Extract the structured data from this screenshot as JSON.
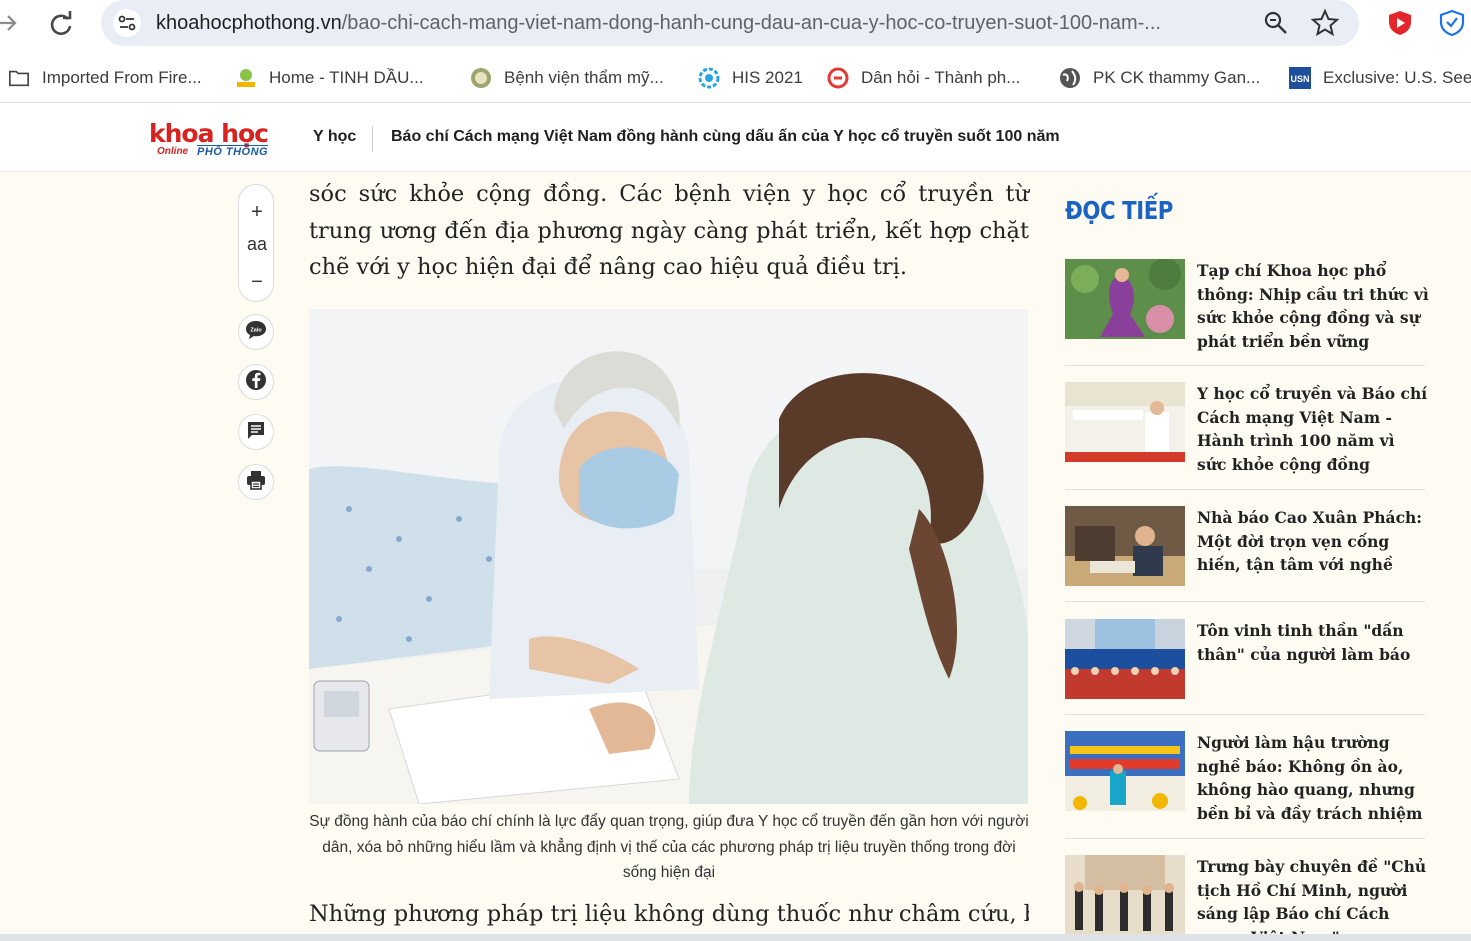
{
  "browser": {
    "url_host": "khoahocphothong.vn",
    "url_path": "/bao-chi-cach-mang-viet-nam-dong-hanh-cung-dau-an-cua-y-hoc-co-truyen-suot-100-nam-...",
    "bookmarks": [
      {
        "label": "Imported From Fire...",
        "icon": "folder-icon"
      },
      {
        "label": "Home - TINH DẦU...",
        "icon": "site-icon"
      },
      {
        "label": "Bệnh viện thẩm mỹ...",
        "icon": "site-icon"
      },
      {
        "label": "HIS 2021",
        "icon": "gear-site-icon"
      },
      {
        "label": "Dân hỏi - Thành ph...",
        "icon": "site-icon"
      },
      {
        "label": "PK CK thammy Gan...",
        "icon": "globe-icon"
      },
      {
        "label": "Exclusive: U.S. Sees",
        "icon": "usn-icon"
      }
    ]
  },
  "header": {
    "logo_main": "khoa học",
    "logo_sub": "Online",
    "logo_sub2": "PHỔ THÔNG",
    "category": "Y học",
    "title": "Báo chí Cách mạng Việt Nam đồng hành cùng dấu ấn của Y học cổ truyền suốt 100 năm"
  },
  "tools": {
    "zoom_in": "+",
    "font_label": "aa",
    "zoom_out": "−"
  },
  "article": {
    "lead": "sóc sức khỏe cộng đồng. Các bệnh viện y học cổ truyền từ trung ương đến địa phương ngày càng phát triển, kết hợp chặt chẽ với y học hiện đại để nâng cao hiệu quả điều trị.",
    "caption": "Sự đồng hành của báo chí chính là lực đẩy quan trọng, giúp đưa Y học cổ truyền đến gần hơn với người dân, xóa bỏ những hiểu lầm và khẳng định vị thế của các phương pháp trị liệu truyền thống trong đời sống hiện đại",
    "lead2": "Những phương pháp trị liệu không dùng thuốc như châm cứu, bấm"
  },
  "sidebar": {
    "title": "ĐỌC TIẾP",
    "items": [
      {
        "title": "Tạp chí Khoa học phổ thông: Nhịp cầu tri thức vì sức khỏe cộng đồng và sự phát triển bền vững"
      },
      {
        "title": "Y học cổ truyền và Báo chí Cách mạng Việt Nam - Hành trình 100 năm vì sức khỏe cộng đồng"
      },
      {
        "title": "Nhà báo Cao Xuân Phách: Một đời trọn vẹn cống hiến, tận tâm với nghề"
      },
      {
        "title": "Tôn vinh tinh thần \"dấn thân\" của người làm báo"
      },
      {
        "title": "Người làm hậu trường nghề báo: Không ồn ào, không hào quang, nhưng bền bỉ và đầy trách nhiệm"
      },
      {
        "title": "Trưng bày chuyên đề \"Chủ tịch Hồ Chí Minh, người sáng lập Báo chí Cách mạng Việt Nam\""
      }
    ]
  },
  "colors": {
    "brand_red": "#d7231f",
    "brand_blue": "#1a63c5",
    "page_bg": "#fdfbf2"
  }
}
